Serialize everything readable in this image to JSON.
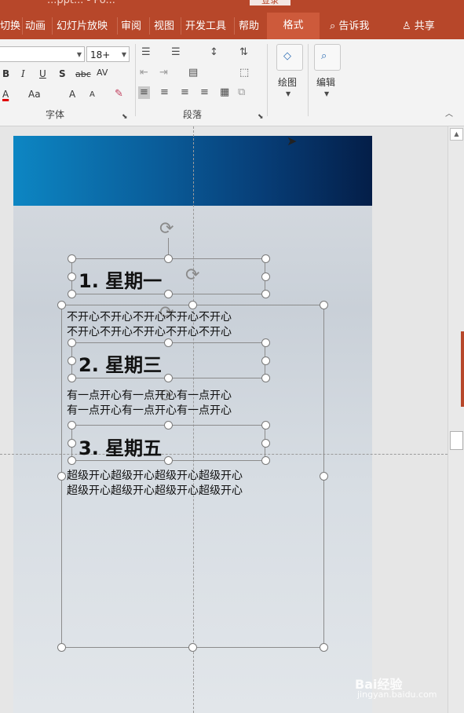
{
  "window": {
    "title": "...ppt... - Po...",
    "sign_in": "登录"
  },
  "tabs": [
    "切换",
    "动画",
    "幻灯片放映",
    "审阅",
    "视图",
    "开发工具",
    "帮助"
  ],
  "active_tab": "格式",
  "tell_me": "告诉我",
  "share": "共享",
  "ribbon": {
    "font_size": "18+",
    "font_group_label": "字体",
    "paragraph_group_label": "段落",
    "drawing_label": "绘图",
    "editing_label": "编辑",
    "bold": "B",
    "italic": "I",
    "underline": "U",
    "shadow": "S",
    "strike": "abc",
    "spacing": "AV",
    "font_color": "A",
    "change_case": "Aa",
    "grow": "A",
    "shrink": "A"
  },
  "slide": {
    "items": [
      {
        "heading": "1. 星期一",
        "line1": "不开心不开心不开心不开心不开心",
        "line2": "不开心不开心不开心不开心不开心"
      },
      {
        "heading": "2. 星期三",
        "line1": "有一点开心有一点开心有一点开心",
        "line2": "有一点开心有一点开心有一点开心"
      },
      {
        "heading": "3. 星期五",
        "line1": "超级开心超级开心超级开心超级开心",
        "line2": "超级开心超级开心超级开心超级开心"
      }
    ]
  },
  "watermark": {
    "brand": "Bai经验",
    "url": "jingyan.baidu.com"
  },
  "colors": {
    "accent": "#b7472a",
    "header_start": "#0d86c3",
    "header_end": "#041e48"
  }
}
